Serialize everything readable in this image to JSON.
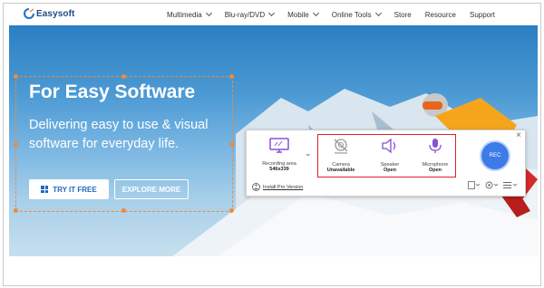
{
  "brand": {
    "name": "Easysoft"
  },
  "nav": {
    "items": [
      {
        "label": "Multimedia",
        "has_dropdown": true
      },
      {
        "label": "Blu-ray/DVD",
        "has_dropdown": true
      },
      {
        "label": "Mobile",
        "has_dropdown": true
      },
      {
        "label": "Online Tools",
        "has_dropdown": true
      },
      {
        "label": "Store",
        "has_dropdown": false
      },
      {
        "label": "Resource",
        "has_dropdown": false
      },
      {
        "label": "Support",
        "has_dropdown": false
      }
    ]
  },
  "hero": {
    "title": "For Easy Software",
    "subtitle": "Delivering easy to use & visual software for everyday life.",
    "try_button": "TRY IT FREE",
    "explore_button": "EXPLORE MORE"
  },
  "recorder": {
    "recording_area": {
      "label": "Recording area",
      "value": "546x339"
    },
    "devices": [
      {
        "label": "Camera",
        "value": "Unavailable",
        "icon": "camera-off-icon"
      },
      {
        "label": "Speaker",
        "value": "Open",
        "icon": "speaker-icon"
      },
      {
        "label": "Microphone",
        "value": "Open",
        "icon": "microphone-icon"
      }
    ],
    "rec_label": "REC",
    "install_label": "Install Pro Version",
    "close_glyph": "×"
  },
  "colors": {
    "accent": "#1f68c0",
    "highlight": "#d9232a",
    "selection": "#f08a3a",
    "rec": "#3d7be8",
    "icon_purple": "#8a4fd8"
  }
}
